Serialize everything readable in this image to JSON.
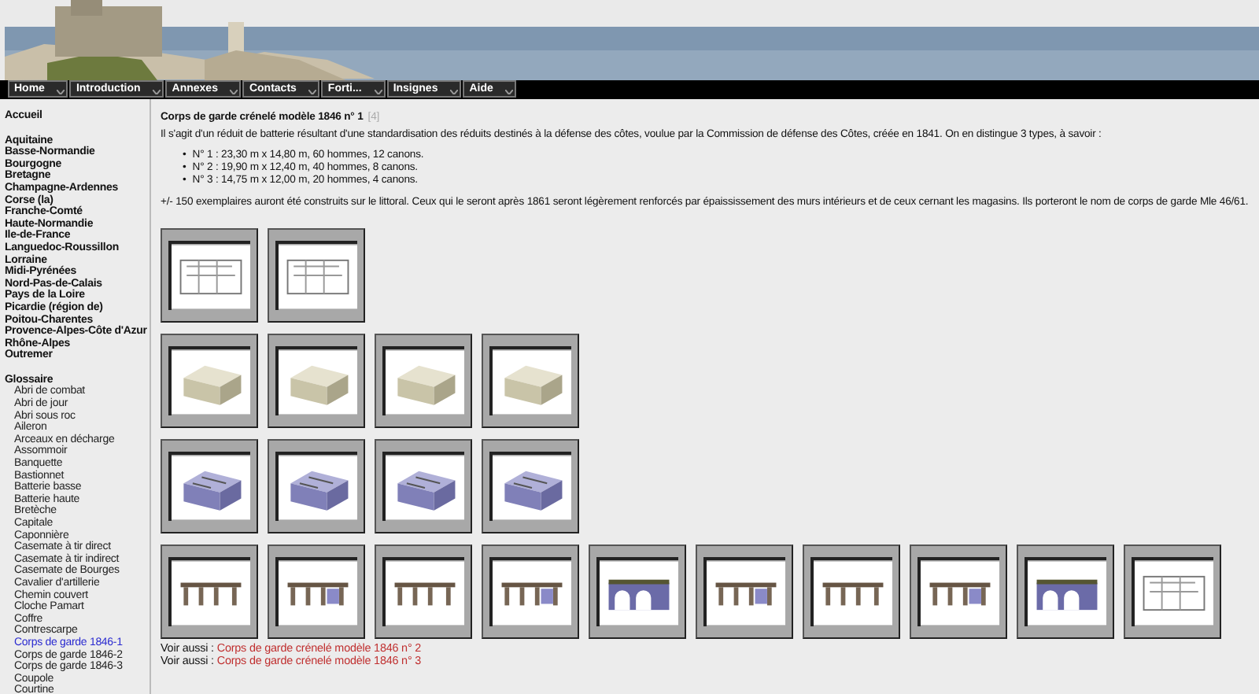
{
  "nav": [
    {
      "label": "Home"
    },
    {
      "label": "Introduction"
    },
    {
      "label": "Annexes"
    },
    {
      "label": "Contacts"
    },
    {
      "label": "Forti..."
    },
    {
      "label": "Insignes"
    },
    {
      "label": "Aide"
    }
  ],
  "sidebar": {
    "home": "Accueil",
    "regions": [
      {
        "label": "Aquitaine"
      },
      {
        "label": "Basse-Normandie"
      },
      {
        "label": "Bourgogne"
      },
      {
        "label": "Bretagne"
      },
      {
        "label": "Champagne-Ardennes"
      },
      {
        "label": "Corse (la)"
      },
      {
        "label": "Franche-Comté"
      },
      {
        "label": "Haute-Normandie"
      },
      {
        "label": "Ile-de-France"
      },
      {
        "label": "Languedoc-Roussillon"
      },
      {
        "label": "Lorraine"
      },
      {
        "label": "Midi-Pyrénées"
      },
      {
        "label": "Nord-Pas-de-Calais"
      },
      {
        "label": "Pays de la Loire"
      },
      {
        "label": "Picardie (région de)"
      },
      {
        "label": "Poitou-Charentes"
      },
      {
        "label": "Provence-Alpes-Côte d'Azur"
      },
      {
        "label": "Rhône-Alpes"
      },
      {
        "label": "Outremer"
      }
    ],
    "glossary_title": "Glossaire",
    "glossary": [
      {
        "label": "Abri de combat",
        "selected": false
      },
      {
        "label": "Abri de jour",
        "selected": false
      },
      {
        "label": "Abri sous roc",
        "selected": false
      },
      {
        "label": "Aileron",
        "selected": false
      },
      {
        "label": "Arceaux en décharge",
        "selected": false
      },
      {
        "label": "Assommoir",
        "selected": false
      },
      {
        "label": "Banquette",
        "selected": false
      },
      {
        "label": "Bastionnet",
        "selected": false
      },
      {
        "label": "Batterie basse",
        "selected": false
      },
      {
        "label": "Batterie haute",
        "selected": false
      },
      {
        "label": "Bretèche",
        "selected": false
      },
      {
        "label": "Capitale",
        "selected": false
      },
      {
        "label": "Caponnière",
        "selected": false
      },
      {
        "label": "Casemate à tir direct",
        "selected": false
      },
      {
        "label": "Casemate à tir indirect",
        "selected": false
      },
      {
        "label": "Casemate de Bourges",
        "selected": false
      },
      {
        "label": "Cavalier d'artillerie",
        "selected": false
      },
      {
        "label": "Chemin couvert",
        "selected": false
      },
      {
        "label": "Cloche Pamart",
        "selected": false
      },
      {
        "label": "Coffre",
        "selected": false
      },
      {
        "label": "Contrescarpe",
        "selected": false
      },
      {
        "label": "Corps de garde 1846-1",
        "selected": true
      },
      {
        "label": "Corps de garde 1846-2",
        "selected": false
      },
      {
        "label": "Corps de garde 1846-3",
        "selected": false
      },
      {
        "label": "Coupole",
        "selected": false
      },
      {
        "label": "Courtine",
        "selected": false
      }
    ]
  },
  "content": {
    "title": "Corps de garde crénelé modèle 1846 n° 1",
    "title_ref": "[4]",
    "intro": "Il s'agit d'un réduit de batterie résultant d'une standardisation des réduits destinés à la défense des côtes, voulue par la Commission de défense des Côtes, créée en 1841. On en distingue 3 types, à savoir :",
    "types": [
      {
        "bullet": "•",
        "text": "N° 1 : 23,30 m x 14,80 m, 60 hommes, 12 canons."
      },
      {
        "bullet": "•",
        "text": "N° 2 : 19,90 m x 12,40 m, 40 hommes, 8 canons."
      },
      {
        "bullet": "•",
        "text": "N° 3 : 14,75 m x 12,00 m, 20 hommes, 4 canons."
      }
    ],
    "note": "+/- 150 exemplaires auront été construits sur le littoral. Ceux qui le seront après 1861 seront légèrement renforcés par épaississement des murs intérieurs et de ceux cernant les magasins. Ils porteront le nom de corps de garde Mle 46/61.",
    "gallery": [
      {
        "thumbnails": [
          {
            "kind": "plan"
          },
          {
            "kind": "plan"
          }
        ]
      },
      {
        "thumbnails": [
          {
            "kind": "block"
          },
          {
            "kind": "block"
          },
          {
            "kind": "block"
          },
          {
            "kind": "block"
          }
        ]
      },
      {
        "thumbnails": [
          {
            "kind": "cutaway"
          },
          {
            "kind": "cutaway"
          },
          {
            "kind": "cutaway"
          },
          {
            "kind": "cutaway"
          }
        ]
      },
      {
        "thumbnails": [
          {
            "kind": "section"
          },
          {
            "kind": "section"
          },
          {
            "kind": "section"
          },
          {
            "kind": "section"
          },
          {
            "kind": "arches"
          },
          {
            "kind": "section"
          },
          {
            "kind": "section"
          },
          {
            "kind": "section"
          },
          {
            "kind": "arches"
          },
          {
            "kind": "plan"
          }
        ]
      }
    ],
    "see_also": [
      {
        "prefix": "Voir aussi :",
        "link": "Corps de garde crénelé modèle 1846 n° 2"
      },
      {
        "prefix": "Voir aussi :",
        "link": "Corps de garde crénelé modèle 1846 n° 3"
      }
    ]
  }
}
